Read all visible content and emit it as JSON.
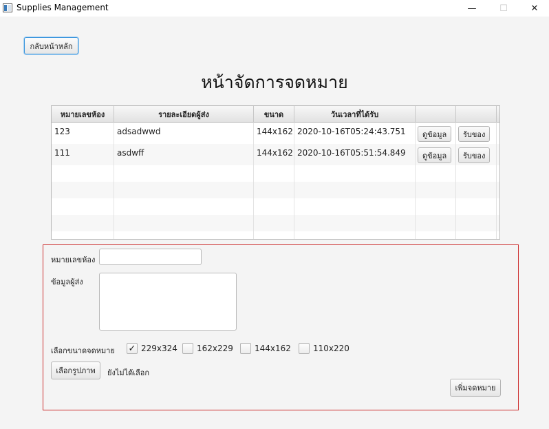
{
  "window": {
    "title": "Supplies Management",
    "minimize_glyph": "—",
    "maximize_glyph": "☐",
    "close_glyph": "✕"
  },
  "back_button": "กลับหน้าหลัก",
  "page_title": "หน้าจัดการจดหมาย",
  "table": {
    "headers": [
      "หมายเลขห้อง",
      "รายละเอียดผู้ส่ง",
      "ขนาด",
      "วันเวลาที่ได้รับ",
      "",
      ""
    ],
    "rows": [
      {
        "room": "123",
        "sender": "adsadwwd",
        "size": "144x162",
        "received": "2020-10-16T05:24:43.751",
        "view_label": "ดูข้อมูล",
        "receive_label": "รับของ"
      },
      {
        "room": "111",
        "sender": "asdwff",
        "size": "144x162",
        "received": "2020-10-16T05:51:54.849",
        "view_label": "ดูข้อมูล",
        "receive_label": "รับของ"
      }
    ]
  },
  "form": {
    "room_label": "หมายเลขห้อง",
    "room_value": "",
    "sender_label": "ข้อมูลผู้ส่ง",
    "sender_value": "",
    "size_label": "เลือกขนาดจดหมาย",
    "size_options": [
      {
        "label": "229x324",
        "checked": true
      },
      {
        "label": "162x229",
        "checked": false
      },
      {
        "label": "144x162",
        "checked": false
      },
      {
        "label": "110x220",
        "checked": false
      }
    ],
    "choose_image_button": "เลือกรูปภาพ",
    "image_status": "ยังไม่ได้เลือก",
    "add_button": "เพิ่มจดหมาย"
  },
  "colors": {
    "form_border": "#cc2b2b",
    "focus_border": "#3a96dd"
  }
}
